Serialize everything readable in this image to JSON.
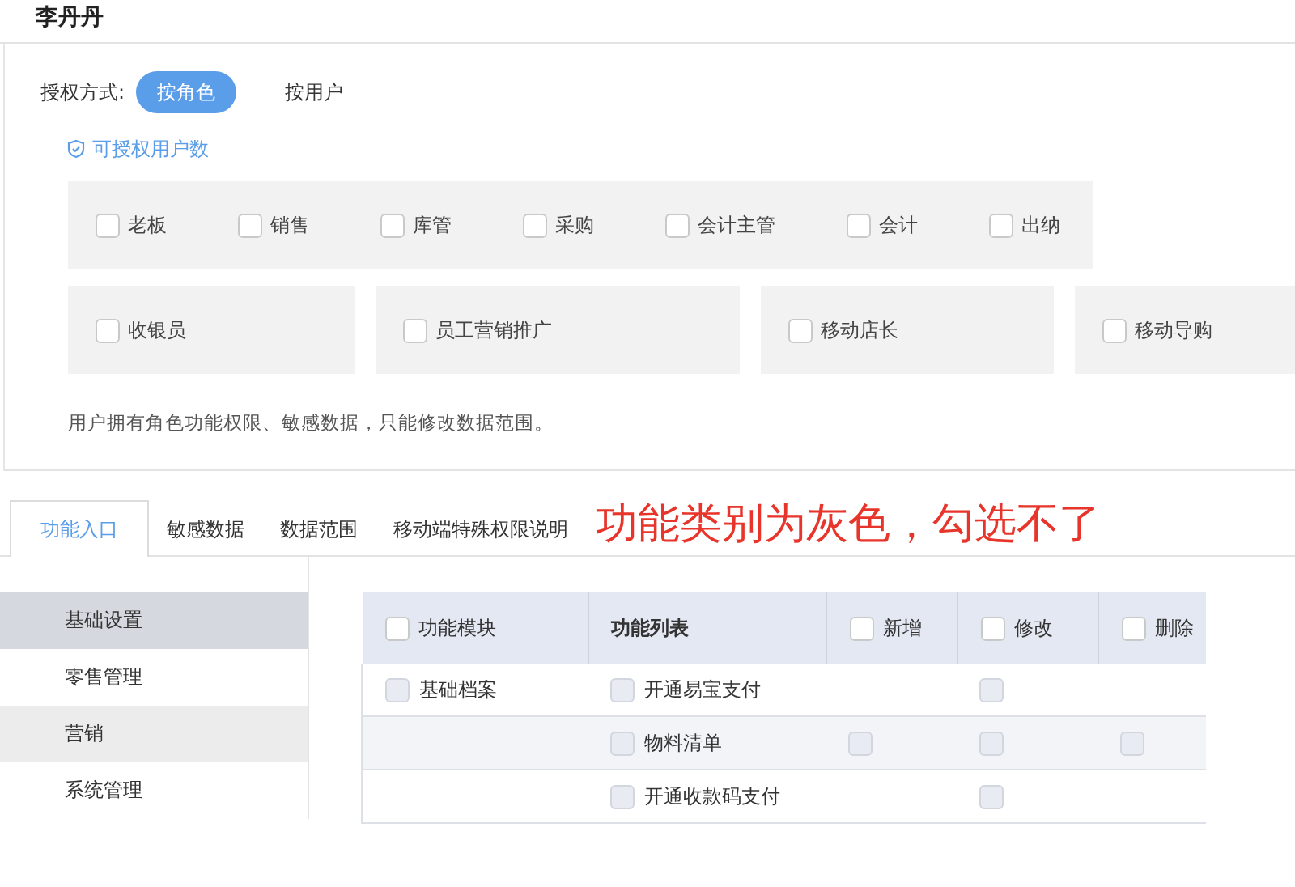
{
  "user_name": "李丹丹",
  "auth_mode": {
    "label": "授权方式:",
    "options": [
      {
        "label": "按角色",
        "selected": true
      },
      {
        "label": "按用户",
        "selected": false
      }
    ]
  },
  "licensed_users_link": "可授权用户数",
  "role_rows": [
    {
      "boxes": [
        {
          "roles": [
            {
              "label": "老板",
              "checked": false
            },
            {
              "label": "销售",
              "checked": false
            },
            {
              "label": "库管",
              "checked": false
            },
            {
              "label": "采购",
              "checked": false
            },
            {
              "label": "会计主管",
              "checked": false
            },
            {
              "label": "会计",
              "checked": false
            },
            {
              "label": "出纳",
              "checked": false
            }
          ]
        }
      ]
    },
    {
      "boxes": [
        {
          "roles": [
            {
              "label": "收银员",
              "checked": false
            }
          ]
        },
        {
          "roles": [
            {
              "label": "员工营销推广",
              "checked": false
            }
          ]
        },
        {
          "roles": [
            {
              "label": "移动店长",
              "checked": false
            }
          ]
        },
        {
          "roles": [
            {
              "label": "移动导购",
              "checked": false
            }
          ]
        }
      ]
    }
  ],
  "note": "用户拥有角色功能权限、敏感数据，只能修改数据范围。",
  "tabs": [
    {
      "label": "功能入口",
      "selected": true
    },
    {
      "label": "敏感数据",
      "selected": false
    },
    {
      "label": "数据范围",
      "selected": false
    },
    {
      "label": "移动端特殊权限说明",
      "selected": false
    }
  ],
  "annotation": "功能类别为灰色，勾选不了",
  "sidebar": {
    "items": [
      {
        "label": "基础设置",
        "selected": true,
        "highlighted": false
      },
      {
        "label": "零售管理",
        "selected": false,
        "highlighted": false
      },
      {
        "label": "营销",
        "selected": false,
        "highlighted": true
      },
      {
        "label": "系统管理",
        "selected": false,
        "highlighted": false
      }
    ]
  },
  "table": {
    "columns": [
      {
        "label": "功能模块",
        "checkbox": {
          "checked": false,
          "disabled": false
        }
      },
      {
        "label": "功能列表"
      },
      {
        "label": "新增",
        "checkbox": {
          "checked": false,
          "disabled": false
        }
      },
      {
        "label": "修改",
        "checkbox": {
          "checked": false,
          "disabled": false
        }
      },
      {
        "label": "删除",
        "checkbox": {
          "checked": false,
          "disabled": false
        }
      }
    ],
    "rows": [
      {
        "cells": [
          {
            "text": "基础档案",
            "checkbox": {
              "checked": false,
              "disabled": true
            }
          },
          {
            "text": "开通易宝支付",
            "checkbox": {
              "checked": false,
              "disabled": true
            }
          },
          null,
          {
            "checkbox": {
              "checked": false,
              "disabled": true
            }
          },
          null
        ]
      },
      {
        "cells": [
          null,
          {
            "text": "物料清单",
            "checkbox": {
              "checked": false,
              "disabled": true
            }
          },
          {
            "checkbox": {
              "checked": false,
              "disabled": true
            }
          },
          {
            "checkbox": {
              "checked": false,
              "disabled": true
            }
          },
          {
            "checkbox": {
              "checked": false,
              "disabled": true
            }
          }
        ]
      },
      {
        "cells": [
          null,
          {
            "text": "开通收款码支付",
            "checkbox": {
              "checked": false,
              "disabled": true
            }
          },
          null,
          {
            "checkbox": {
              "checked": false,
              "disabled": true
            }
          },
          null
        ]
      }
    ]
  }
}
